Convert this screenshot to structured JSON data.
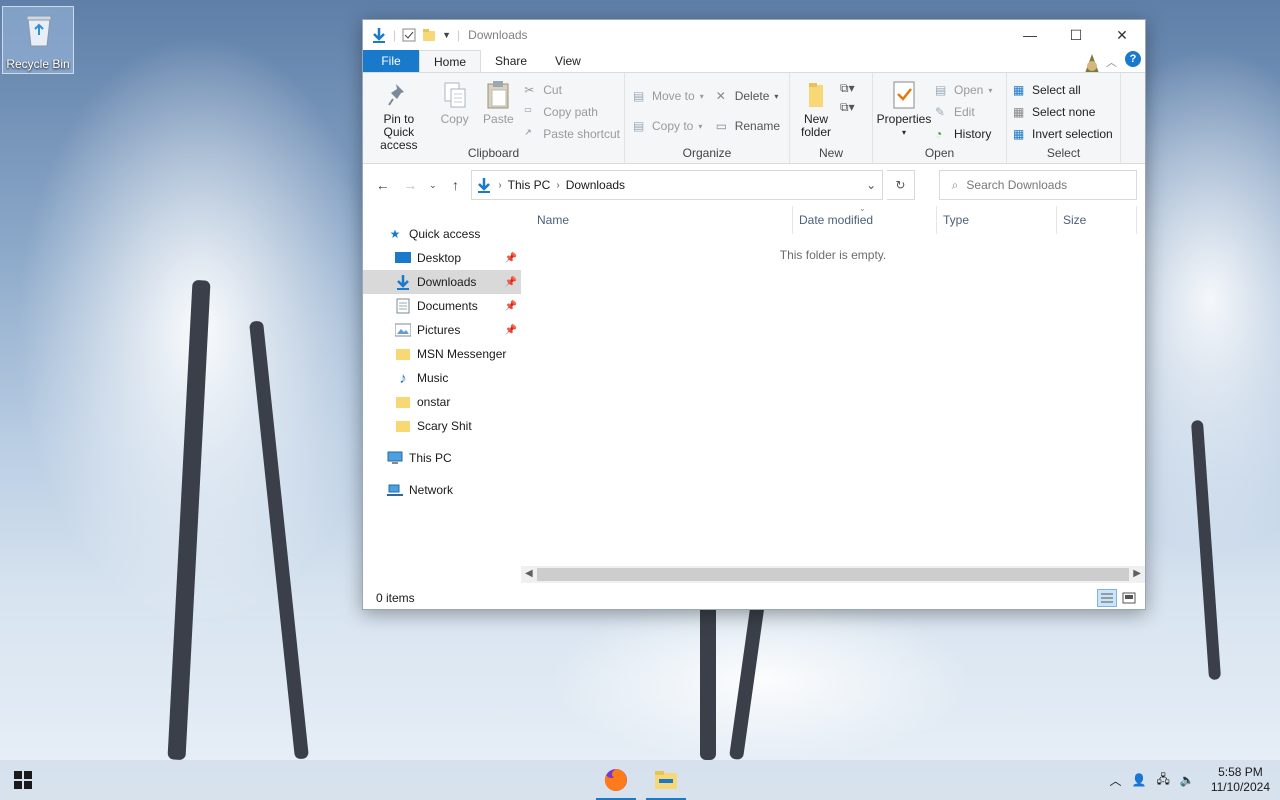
{
  "desktop": {
    "recycle_bin_label": "Recycle Bin"
  },
  "window": {
    "title": "Downloads",
    "controls": {
      "minimize": "—",
      "maximize": "☐",
      "close": "✕"
    },
    "tabs": [
      {
        "label": "File"
      },
      {
        "label": "Home"
      },
      {
        "label": "Share"
      },
      {
        "label": "View"
      }
    ],
    "ribbon": {
      "clipboard": {
        "name": "Clipboard",
        "pin_label": "Pin to Quick access",
        "copy_label": "Copy",
        "paste_label": "Paste",
        "cut_label": "Cut",
        "copy_path_label": "Copy path",
        "paste_shortcut_label": "Paste shortcut"
      },
      "organize": {
        "name": "Organize",
        "move_to_label": "Move to",
        "copy_to_label": "Copy to",
        "delete_label": "Delete",
        "rename_label": "Rename"
      },
      "new": {
        "name": "New",
        "new_folder_label": "New folder"
      },
      "open": {
        "name": "Open",
        "properties_label": "Properties",
        "open_label": "Open",
        "edit_label": "Edit",
        "history_label": "History"
      },
      "select": {
        "name": "Select",
        "select_all_label": "Select all",
        "select_none_label": "Select none",
        "invert_label": "Invert selection"
      }
    },
    "address": {
      "crumbs": [
        "This PC",
        "Downloads"
      ],
      "search_placeholder": "Search Downloads"
    },
    "nav": {
      "quick_access": "Quick access",
      "items": [
        {
          "label": "Desktop"
        },
        {
          "label": "Downloads"
        },
        {
          "label": "Documents"
        },
        {
          "label": "Pictures"
        },
        {
          "label": "MSN Messenger"
        },
        {
          "label": "Music"
        },
        {
          "label": "onstar"
        },
        {
          "label": "Scary Shit"
        }
      ],
      "this_pc": "This PC",
      "network": "Network"
    },
    "columns": [
      "Name",
      "Date modified",
      "Type",
      "Size"
    ],
    "empty_message": "This folder is empty.",
    "status": "0 items"
  },
  "taskbar": {
    "time": "5:58 PM",
    "date": "11/10/2024"
  },
  "colors": {
    "accent": "#1979ca",
    "folder": "#f8d775"
  }
}
